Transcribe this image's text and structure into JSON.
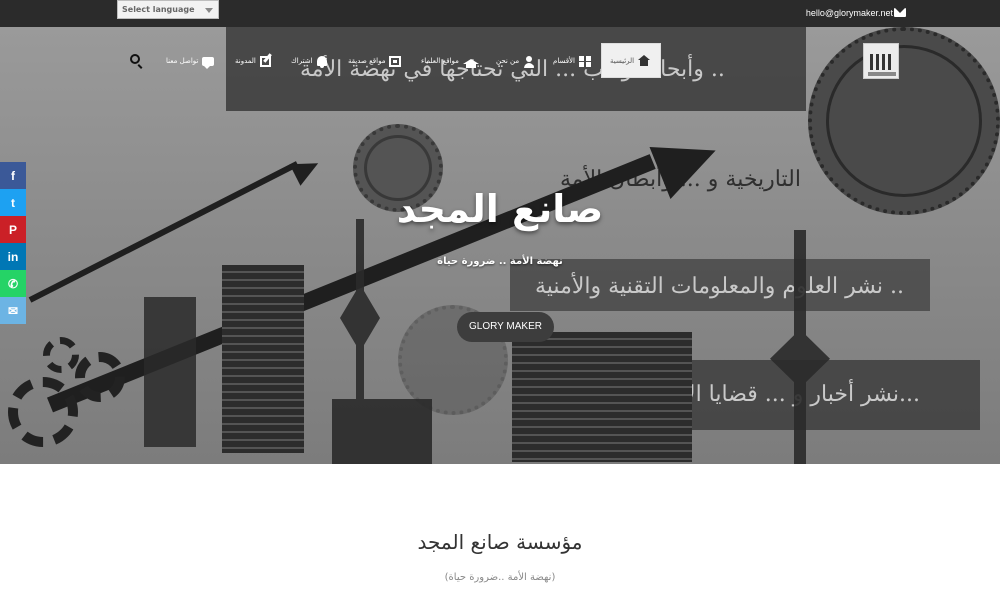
{
  "topbar": {
    "language_select": "Select language",
    "email": "hello@glorymaker.net"
  },
  "nav": {
    "items": [
      {
        "label": "الرئيسية",
        "icon": "home-icon"
      },
      {
        "label": "الأقسام",
        "icon": "grid-icon"
      },
      {
        "label": "من نحن",
        "icon": "user-icon"
      },
      {
        "label": "مواقع العلماء",
        "icon": "graduation-cap-icon"
      },
      {
        "label": "مواقع صديقة",
        "icon": "newspaper-icon"
      },
      {
        "label": "اشتراك",
        "icon": "bell-icon"
      },
      {
        "label": "المدونة",
        "icon": "edit-icon"
      },
      {
        "label": "تواصل معنا",
        "icon": "chat-icon"
      }
    ],
    "search_icon": "search-icon"
  },
  "hero": {
    "title": "صانع المجد",
    "subtitle": "نهضة الأمة .. ضرورة حياة",
    "button": "GLORY MAKER",
    "background_texts": [
      "وأبحاث وكتب ... التي تحتاجها في نهضة الأمة ..",
      "التاريخية و ... وأبطال الأمة",
      "نشر العلوم والمعلومات التقنية والأمنية ..",
      "نشر أخبار و ... قضايا الأمة الم..."
    ]
  },
  "social": [
    {
      "name": "facebook",
      "glyph": "f",
      "color": "#3b5998"
    },
    {
      "name": "twitter",
      "glyph": "t",
      "color": "#1da1f2"
    },
    {
      "name": "pinterest",
      "glyph": "P",
      "color": "#cb2027"
    },
    {
      "name": "linkedin",
      "glyph": "in",
      "color": "#0077b5"
    },
    {
      "name": "whatsapp",
      "glyph": "✆",
      "color": "#25d366"
    },
    {
      "name": "email",
      "glyph": "✉",
      "color": "#6cb4e4"
    }
  ],
  "section": {
    "title": "مؤسسة صانع المجد",
    "subtitle": "(نهضة الأمة ..ضرورة حياة)"
  }
}
